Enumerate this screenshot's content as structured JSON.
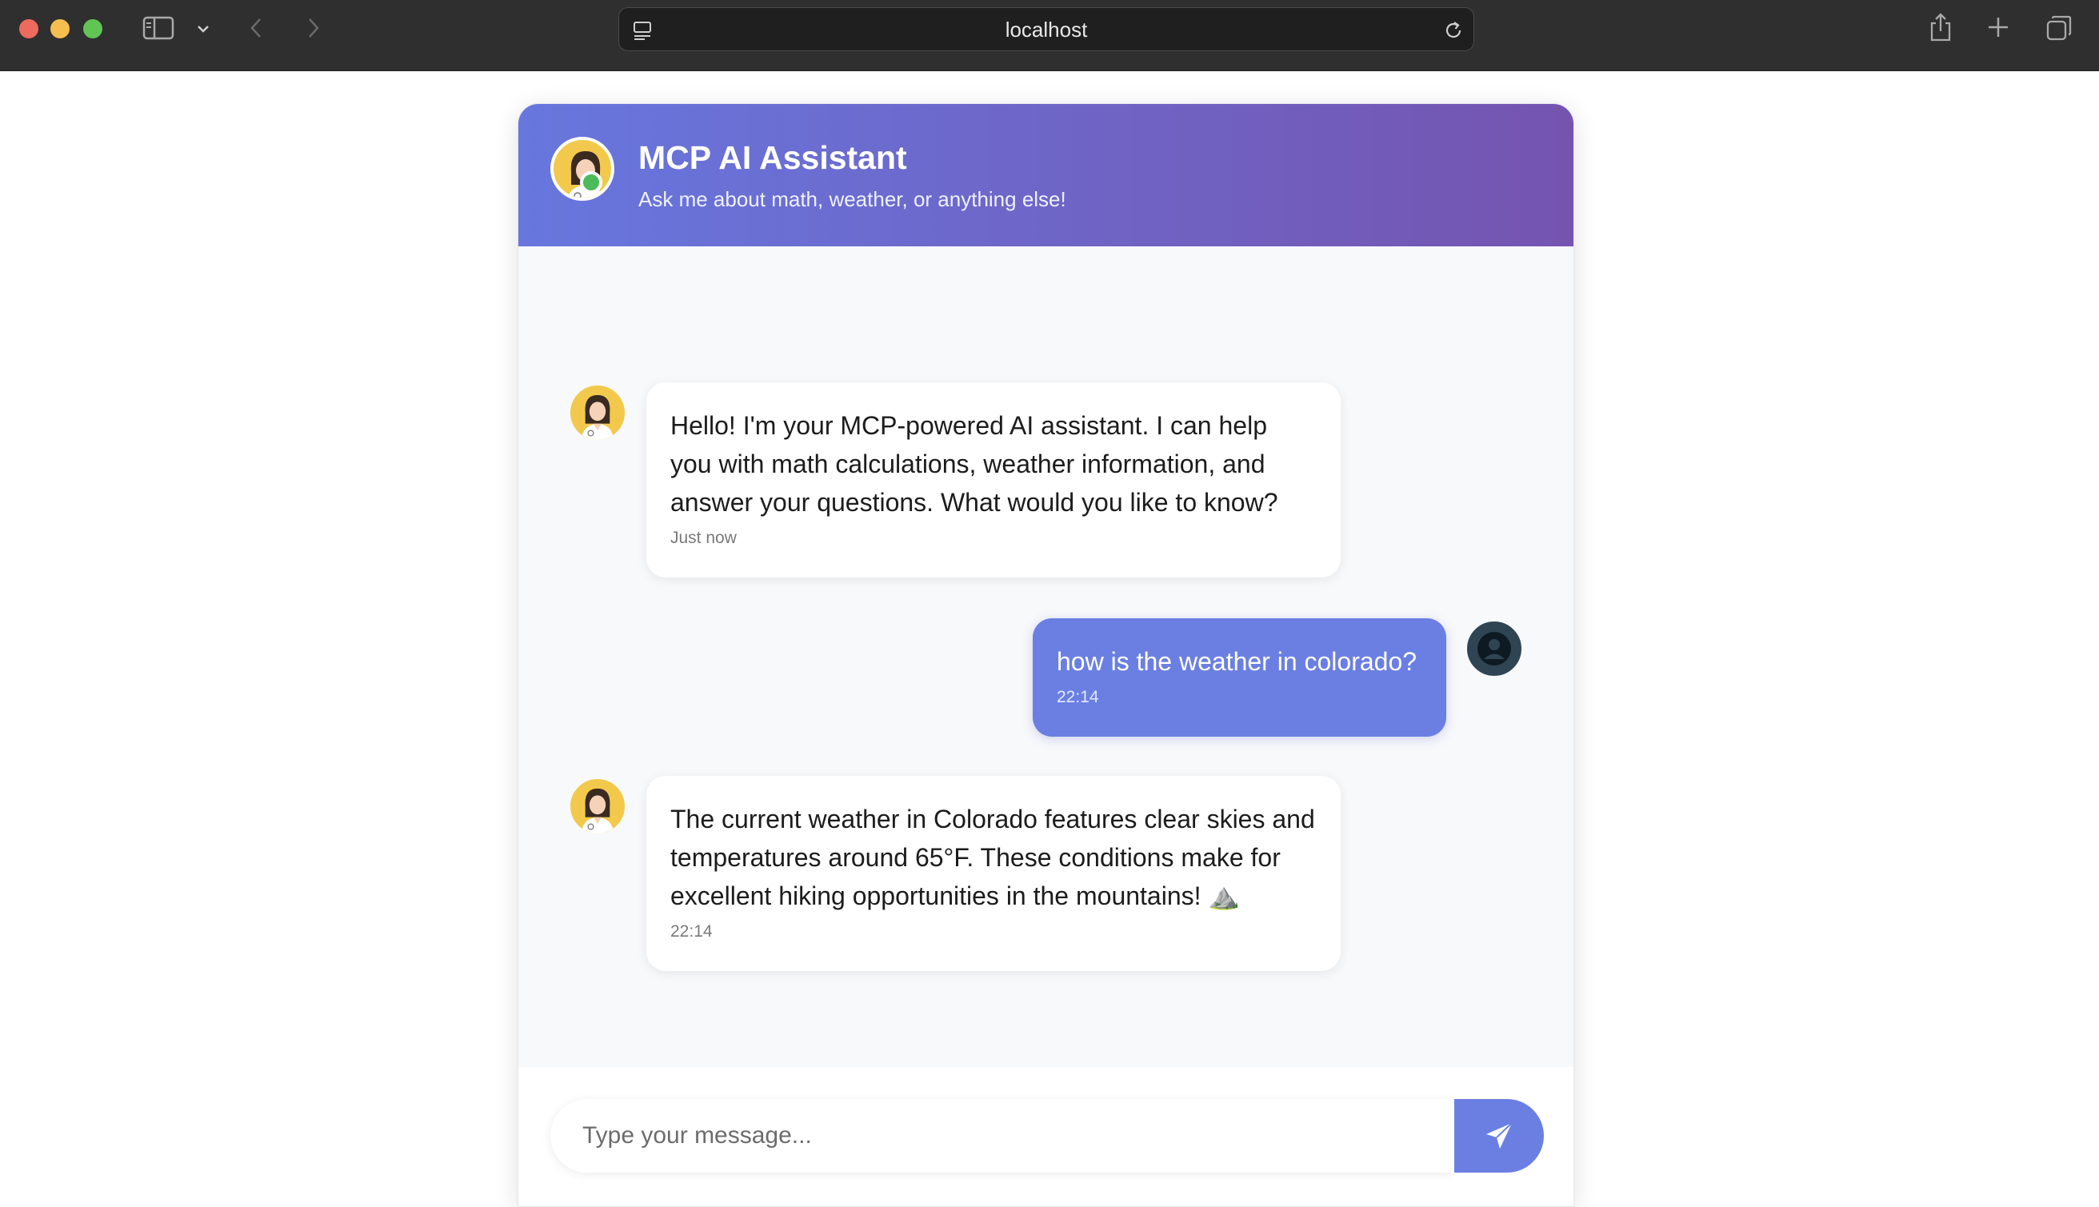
{
  "browser": {
    "url": "localhost",
    "icons": [
      "sidebar-icon",
      "chevron-down-icon",
      "back-icon",
      "forward-icon",
      "site-settings-icon",
      "reload-icon",
      "share-icon",
      "new-tab-icon",
      "tabs-overview-icon"
    ]
  },
  "header": {
    "title": "MCP AI Assistant",
    "subtitle": "Ask me about math, weather, or anything else!",
    "status": "online"
  },
  "messages": [
    {
      "sender": "assistant",
      "text": "Hello! I'm your MCP-powered AI assistant. I can help you with math calculations, weather information, and answer your questions. What would you like to know?",
      "time": "Just now"
    },
    {
      "sender": "user",
      "text": "how is the weather in colorado?",
      "time": "22:14"
    },
    {
      "sender": "assistant",
      "text": "The current weather in Colorado features clear skies and temperatures around 65°F. These conditions make for excellent hiking opportunities in the mountains! ⛰️",
      "time": "22:14"
    }
  ],
  "composer": {
    "placeholder": "Type your message...",
    "value": "",
    "send_icon": "send-icon"
  },
  "colors": {
    "header_gradient_start": "#6777de",
    "header_gradient_end": "#7554b0",
    "user_bubble": "#6b7fe3",
    "online": "#4cbb5a"
  }
}
